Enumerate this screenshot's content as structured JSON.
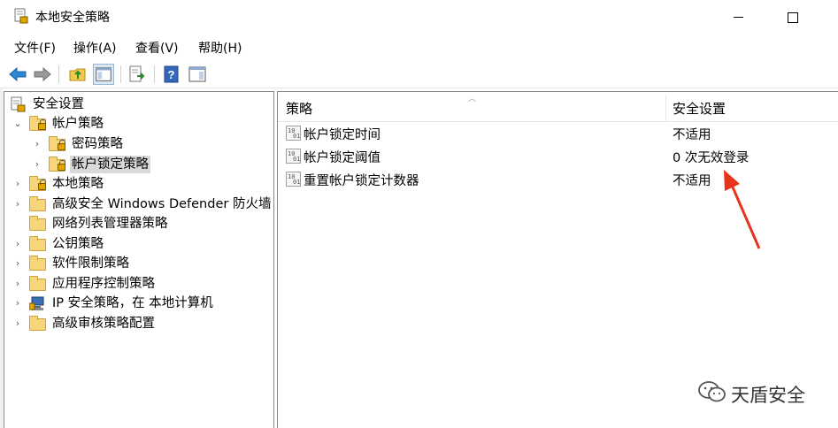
{
  "window": {
    "title": "本地安全策略"
  },
  "menu": [
    {
      "label": "文件(F)"
    },
    {
      "label": "操作(A)"
    },
    {
      "label": "查看(V)"
    },
    {
      "label": "帮助(H)"
    }
  ],
  "toolbar": {
    "buttons": [
      "back-arrow-icon",
      "forward-arrow-icon",
      "up-folder-icon",
      "show-hide-tree-icon",
      "export-list-icon",
      "help-icon",
      "properties-icon"
    ]
  },
  "tree": {
    "root": {
      "label": "安全设置"
    },
    "items": [
      {
        "label": "帐户策略",
        "expander": "⌄"
      },
      {
        "label": "密码策略",
        "expander": "›"
      },
      {
        "label": "帐户锁定策略",
        "expander": "›"
      },
      {
        "label": "本地策略",
        "expander": "›"
      },
      {
        "label": "高级安全 Windows Defender 防火墙",
        "expander": "›"
      },
      {
        "label": "网络列表管理器策略",
        "expander": ""
      },
      {
        "label": "公钥策略",
        "expander": "›"
      },
      {
        "label": "软件限制策略",
        "expander": "›"
      },
      {
        "label": "应用程序控制策略",
        "expander": "›"
      },
      {
        "label": "IP 安全策略，在 本地计算机",
        "expander": "›"
      },
      {
        "label": "高级审核策略配置",
        "expander": "›"
      }
    ]
  },
  "list": {
    "headers": {
      "policy": "策略",
      "setting": "安全设置"
    },
    "rows": [
      {
        "policy": "帐户锁定时间",
        "setting": "不适用"
      },
      {
        "policy": "帐户锁定阈值",
        "setting": "0 次无效登录"
      },
      {
        "policy": "重置帐户锁定计数器",
        "setting": "不适用"
      }
    ]
  },
  "watermark": {
    "text": "天盾安全"
  },
  "colors": {
    "annotation_arrow": "#e8341c",
    "selection": "#d9d9d9",
    "folder": "#f7d57a"
  }
}
